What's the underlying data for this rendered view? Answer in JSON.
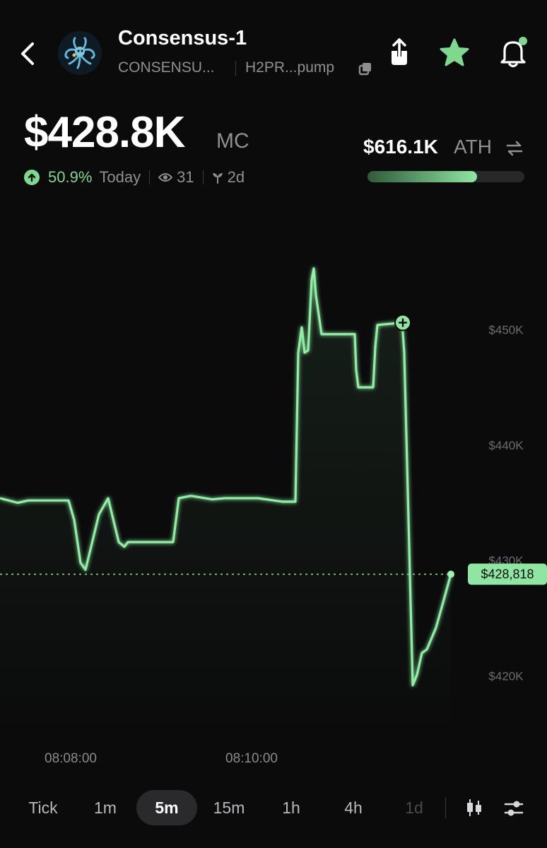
{
  "header": {
    "token_name": "Consensus-1",
    "symbol": "CONSENSU...",
    "address": "H2PR...pump",
    "icons": [
      "back-chevron-icon",
      "token-avatar",
      "copy-icon",
      "share-icon",
      "star-icon",
      "bell-icon"
    ],
    "favorited": true,
    "notification_dot": true
  },
  "price": {
    "market_cap": "$428.8K",
    "mc_label": "MC",
    "ath_value": "$616.1K",
    "ath_label": "ATH",
    "ath_progress": 0.7
  },
  "stats": {
    "change_pct": "50.9%",
    "change_period": "Today",
    "viewers": "31",
    "age": "2d"
  },
  "colors": {
    "accent": "#7ed98f",
    "background": "#0b0b0c",
    "muted": "#8f8f94"
  },
  "chart_data": {
    "type": "line",
    "ylim": [
      416000,
      457000
    ],
    "y_ticks": [
      "$450K",
      "$440K",
      "$430K",
      "$420K"
    ],
    "y_tick_values": [
      450000,
      440000,
      430000,
      420000
    ],
    "x_ticks": [
      "08:08:00",
      "08:10:00"
    ],
    "current_value": 428818,
    "current_label": "$428,818",
    "series": [
      {
        "values": [
          [
            0,
            435400
          ],
          [
            25,
            435000
          ],
          [
            40,
            435200
          ],
          [
            97,
            435200
          ],
          [
            105,
            433500
          ],
          [
            114,
            429800
          ],
          [
            121,
            429200
          ],
          [
            140,
            434000
          ],
          [
            153,
            435400
          ],
          [
            168,
            431600
          ],
          [
            176,
            431200
          ],
          [
            181,
            431600
          ],
          [
            245,
            431600
          ],
          [
            253,
            435400
          ],
          [
            270,
            435600
          ],
          [
            300,
            435300
          ],
          [
            318,
            435400
          ],
          [
            365,
            435400
          ],
          [
            400,
            435100
          ],
          [
            418,
            435100
          ],
          [
            422,
            448000
          ],
          [
            427,
            450200
          ],
          [
            431,
            448000
          ],
          [
            436,
            448200
          ],
          [
            441,
            454300
          ],
          [
            444,
            455300
          ],
          [
            447,
            453000
          ],
          [
            455,
            449600
          ],
          [
            502,
            449600
          ],
          [
            504,
            446500
          ],
          [
            507,
            445000
          ],
          [
            528,
            445000
          ],
          [
            531,
            448500
          ],
          [
            534,
            450400
          ],
          [
            569,
            450600
          ],
          [
            572,
            448000
          ],
          [
            584,
            419200
          ],
          [
            590,
            420100
          ],
          [
            597,
            422000
          ],
          [
            604,
            422300
          ],
          [
            617,
            424200
          ],
          [
            628,
            426600
          ],
          [
            638,
            428818
          ]
        ]
      }
    ],
    "marker_point": [
      570,
      450600
    ]
  },
  "timeframes": {
    "items": [
      "Tick",
      "1m",
      "5m",
      "15m",
      "1h",
      "4h",
      "1d"
    ],
    "active": "5m",
    "icons": [
      "candlestick-icon",
      "settings-sliders-icon"
    ]
  }
}
